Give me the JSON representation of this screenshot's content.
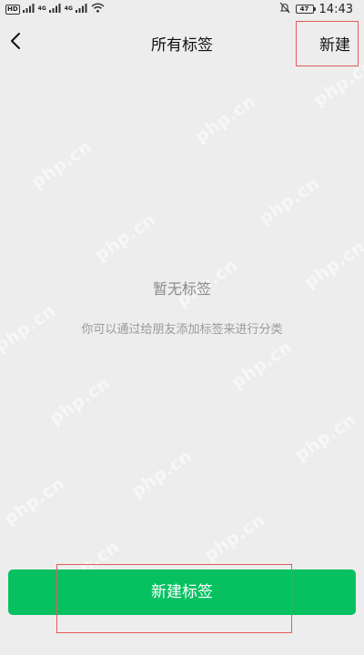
{
  "status_bar": {
    "sim1": "HD",
    "sim2": "HD",
    "net1": "4G",
    "net2": "4G",
    "battery": "47",
    "time": "14:43"
  },
  "nav": {
    "title": "所有标签",
    "new_label": "新建"
  },
  "empty_state": {
    "title": "暂无标签",
    "description": "你可以通过给朋友添加标签来进行分类"
  },
  "bottom": {
    "create_label": "新建标签"
  },
  "watermark": {
    "text": "php.cn"
  },
  "colors": {
    "background": "#ededed",
    "accent_green": "#07c160",
    "annotation_red": "#e45a5a"
  }
}
